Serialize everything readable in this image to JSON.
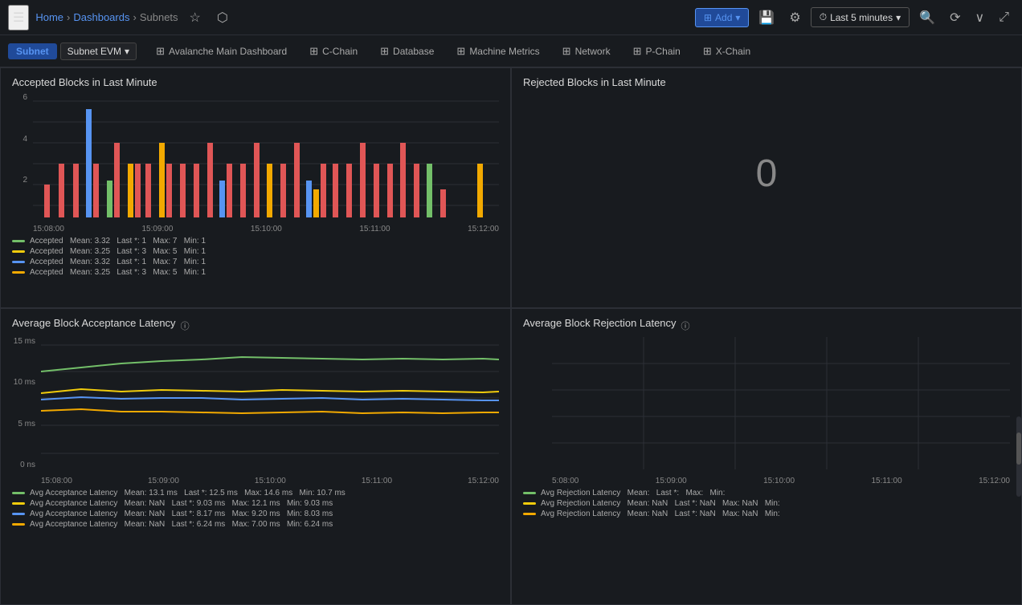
{
  "topbar": {
    "hamburger": "☰",
    "breadcrumb": {
      "home": "Home",
      "dashboards": "Dashboards",
      "separator1": "›",
      "separator2": "›",
      "current": "Subnets"
    },
    "star_icon": "☆",
    "share_icon": "⬡",
    "add_label": "Add",
    "save_icon": "💾",
    "settings_icon": "⚙",
    "time_label": "Last 5 minutes",
    "zoom_icon": "🔍",
    "refresh_icon": "⟳",
    "more_icon": "∨",
    "expand_icon": "⤢"
  },
  "tabbar": {
    "subnet_label": "Subnet",
    "subnet_evm": "Subnet EVM",
    "tabs": [
      {
        "id": "avalanche-main",
        "label": "Avalanche Main Dashboard",
        "icon": "⊞"
      },
      {
        "id": "c-chain",
        "label": "C-Chain",
        "icon": "⊞"
      },
      {
        "id": "database",
        "label": "Database",
        "icon": "⊞"
      },
      {
        "id": "machine-metrics",
        "label": "Machine Metrics",
        "icon": "⊞"
      },
      {
        "id": "network",
        "label": "Network",
        "icon": "⊞"
      },
      {
        "id": "p-chain",
        "label": "P-Chain",
        "icon": "⊞"
      },
      {
        "id": "x-chain",
        "label": "X-Chain",
        "icon": "⊞"
      }
    ]
  },
  "panels": {
    "accepted_blocks": {
      "title": "Accepted Blocks in Last Minute",
      "x_labels": [
        "15:08:00",
        "15:09:00",
        "15:10:00",
        "15:11:00",
        "15:12:00"
      ],
      "y_labels": [
        "6",
        "4",
        "2"
      ],
      "legend": [
        {
          "color": "#73bf69",
          "type": "bar",
          "label": "Accepted",
          "mean": "3.32",
          "last": "1",
          "max": "7",
          "min": "1"
        },
        {
          "color": "#f2cc0c",
          "type": "bar",
          "label": "Accepted",
          "mean": "3.25",
          "last": "3",
          "max": "5",
          "min": "1"
        },
        {
          "color": "#5794f2",
          "type": "bar",
          "label": "Accepted",
          "mean": "3.32",
          "last": "1",
          "max": "7",
          "min": "1"
        },
        {
          "color": "#f2a900",
          "type": "bar",
          "label": "Accepted",
          "mean": "3.25",
          "last": "3",
          "max": "5",
          "min": "1"
        }
      ]
    },
    "rejected_blocks": {
      "title": "Rejected Blocks in Last Minute",
      "value": "0"
    },
    "avg_acceptance_latency": {
      "title": "Average Block Acceptance Latency",
      "x_labels": [
        "15:08:00",
        "15:09:00",
        "15:10:00",
        "15:11:00",
        "15:12:00"
      ],
      "y_labels": [
        "15 ms",
        "10 ms",
        "5 ms",
        "0 ns"
      ],
      "legend": [
        {
          "color": "#73bf69",
          "type": "line",
          "label": "Avg Acceptance Latency",
          "mean": "13.1 ms",
          "last": "12.5 ms",
          "max": "14.6 ms",
          "min": "10.7 ms"
        },
        {
          "color": "#f2cc0c",
          "type": "line",
          "label": "Avg Acceptance Latency",
          "mean": "NaN",
          "last": "9.03 ms",
          "max": "12.1 ms",
          "min": "9.03 ms"
        },
        {
          "color": "#5794f2",
          "type": "line",
          "label": "Avg Acceptance Latency",
          "mean": "NaN",
          "last": "8.17 ms",
          "max": "9.20 ms",
          "min": "8.03 ms"
        },
        {
          "color": "#f2a900",
          "type": "line",
          "label": "Avg Acceptance Latency",
          "mean": "NaN",
          "last": "6.24 ms",
          "max": "7.00 ms",
          "min": "6.24 ms"
        }
      ]
    },
    "avg_rejection_latency": {
      "title": "Average Block Rejection Latency",
      "x_labels": [
        "5:08:00",
        "15:09:00",
        "15:10:00",
        "15:11:00",
        "15:12:00"
      ],
      "legend": [
        {
          "color": "#73bf69",
          "type": "line",
          "label": "Avg Rejection Latency",
          "mean": "",
          "last": "",
          "max": "",
          "min": ""
        },
        {
          "color": "#f2cc0c",
          "type": "line",
          "label": "Avg Rejection Latency",
          "mean": "NaN",
          "last": "NaN",
          "max": "NaN",
          "min": ""
        },
        {
          "color": "#f2a900",
          "type": "line",
          "label": "Avg Rejection Latency",
          "mean": "NaN",
          "last": "NaN",
          "max": "NaN",
          "min": ""
        }
      ]
    }
  }
}
